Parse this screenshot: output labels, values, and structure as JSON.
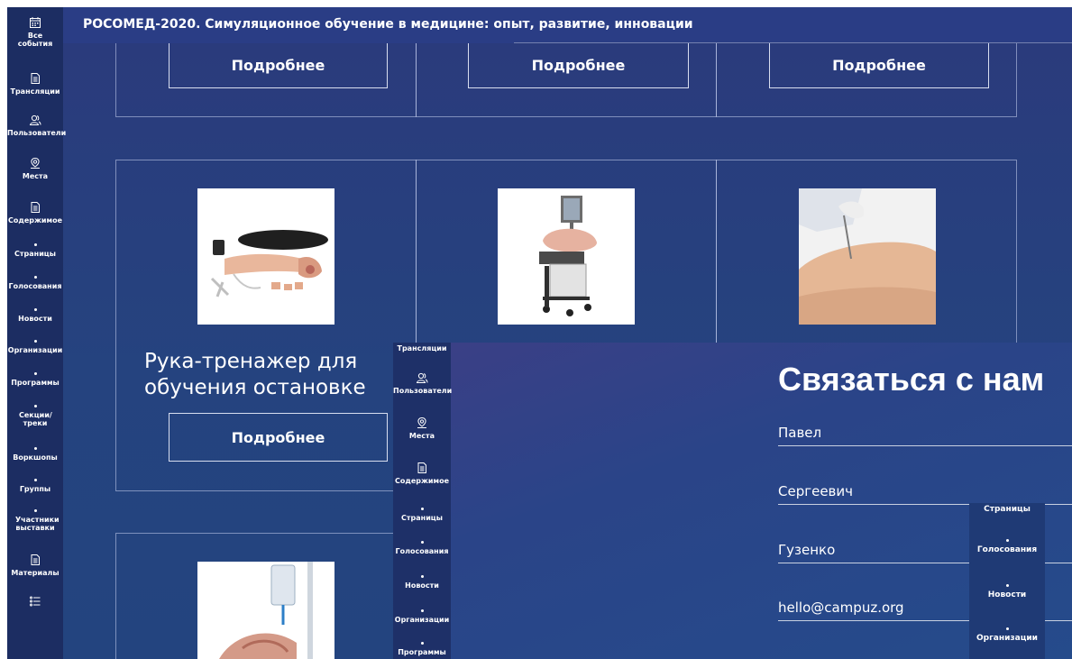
{
  "header": {
    "title": "РОСОМЕД-2020. Симуляционное обучение в медицине: опыт, развитие, инновации"
  },
  "sidebar": {
    "items": [
      {
        "label": "Все события",
        "icon": "calendar-icon"
      },
      {
        "label": "Трансляции",
        "icon": "document-icon"
      },
      {
        "label": "Пользователи",
        "icon": "users-icon"
      },
      {
        "label": "Места",
        "icon": "location-icon"
      },
      {
        "label": "Содержимое",
        "icon": "document-icon"
      },
      {
        "label": "Страницы",
        "icon": "dot-icon"
      },
      {
        "label": "Голосования",
        "icon": "dot-icon"
      },
      {
        "label": "Новости",
        "icon": "dot-icon"
      },
      {
        "label": "Организации",
        "icon": "dot-icon"
      },
      {
        "label": "Программы",
        "icon": "dot-icon"
      },
      {
        "label": "Секции/ треки",
        "icon": "dot-icon"
      },
      {
        "label": "Воркшопы",
        "icon": "dot-icon"
      },
      {
        "label": "Группы",
        "icon": "dot-icon"
      },
      {
        "label": "Участники выставки",
        "icon": "dot-icon"
      },
      {
        "label": "Материалы",
        "icon": "document-icon"
      },
      {
        "label": "",
        "icon": "list-icon"
      }
    ]
  },
  "grid": {
    "more_label": "Подробнее",
    "product_title": "Рука-тренажер для обучения остановке"
  },
  "overlay": {
    "sidebar": [
      {
        "label": "Трансляции"
      },
      {
        "label": "Пользователи",
        "icon": "users-icon"
      },
      {
        "label": "Места",
        "icon": "location-icon"
      },
      {
        "label": "Содержимое",
        "icon": "document-icon"
      },
      {
        "label": "Страницы"
      },
      {
        "label": "Голосования"
      },
      {
        "label": "Новости"
      },
      {
        "label": "Организации"
      },
      {
        "label": "Программы"
      }
    ],
    "title": "Связаться с нам",
    "fields": [
      "Павел",
      "Сергеевич",
      "Гузенко",
      "hello@campuz.org"
    ],
    "mini_sidebar": [
      {
        "label": "Страницы"
      },
      {
        "label": "Голосования"
      },
      {
        "label": "Новости"
      },
      {
        "label": "Организации"
      }
    ]
  },
  "colors": {
    "background": "#25437f",
    "sidebar": "#1c2d62",
    "header": "#2a3d85",
    "text": "#ffffff"
  }
}
